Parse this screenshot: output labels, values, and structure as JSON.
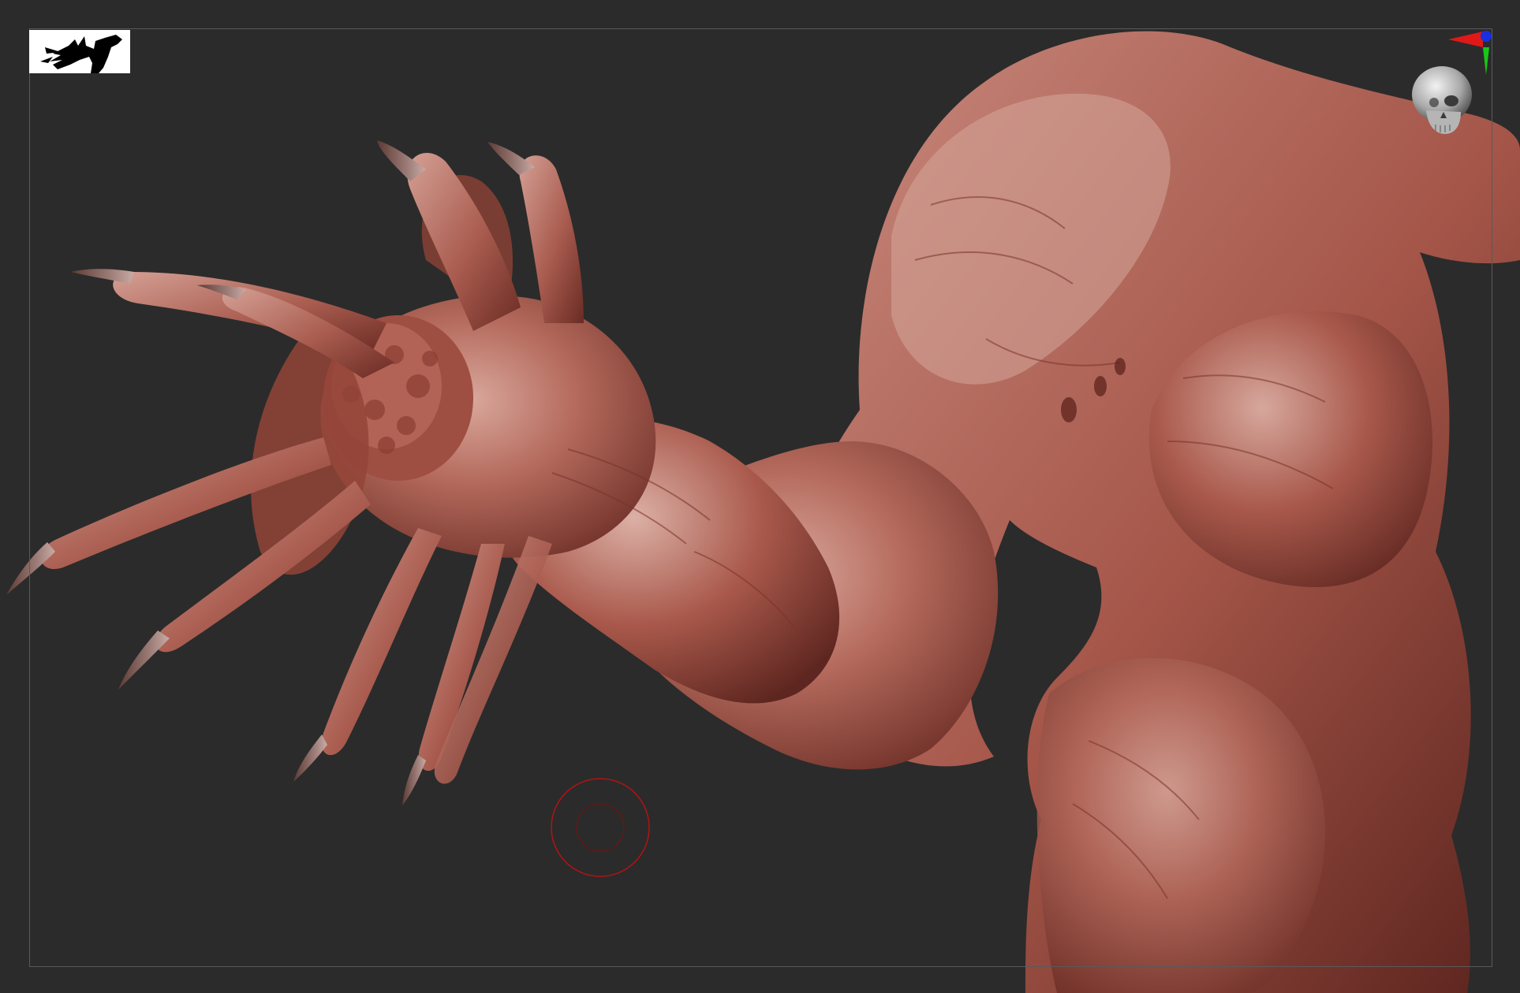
{
  "app": {
    "viewport_name": "3D Viewport",
    "background_color": "#2b2b2b",
    "frame_color": "#5a5a5a",
    "material_color": "#b06a5e"
  },
  "icons": {
    "thumbnail": "silhouette-thumbnail-icon",
    "brush_cursor": "brush-cursor-icon",
    "orientation_gizmo": "skull-orientation-gizmo-icon"
  },
  "gizmo": {
    "axis_colors": {
      "x": "#e01818",
      "y": "#18c818",
      "z": "#1830e0"
    }
  },
  "brush": {
    "outer_color": "#b01414",
    "inner_color": "#7a1010"
  }
}
